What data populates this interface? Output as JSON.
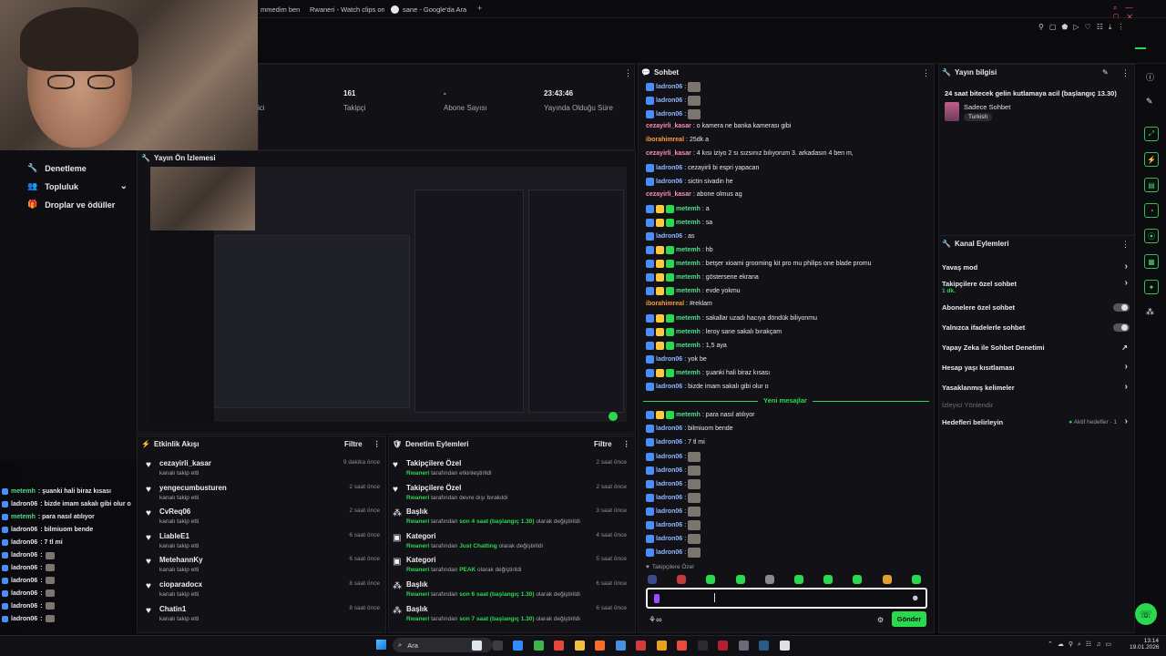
{
  "browser_tabs": [
    {
      "label": "mmedim ben"
    },
    {
      "label": "Rwaneri - Watch clips on"
    },
    {
      "label": "sane - Google'da Ara"
    }
  ],
  "left_nav": {
    "items": [
      {
        "label": "Denetleme",
        "icon": "wrench-icon"
      },
      {
        "label": "Topluluk",
        "icon": "people-icon"
      },
      {
        "label": "Droplar ve ödüller",
        "icon": "gift-icon"
      }
    ]
  },
  "stats": [
    {
      "value": "",
      "label": "ici"
    },
    {
      "value": "161",
      "label": "Takipçi"
    },
    {
      "value": "-",
      "label": "Abone Sayısı"
    },
    {
      "value": "23:43:46",
      "label": "Yayında Olduğu Süre"
    }
  ],
  "preview": {
    "title": "Yayın Ön İzlemesi"
  },
  "activity": {
    "title": "Etkinlik Akışı",
    "filter": "Filtre",
    "rows": [
      {
        "name": "cezayirli_kasar",
        "sub": "kanalı takip etti",
        "time": "9 dakika önce"
      },
      {
        "name": "yengecumbusturen",
        "sub": "kanalı takip etti",
        "time": "2 saat önce"
      },
      {
        "name": "CvReq06",
        "sub": "kanalı takip etti",
        "time": "2 saat önce"
      },
      {
        "name": "LiableE1",
        "sub": "kanalı takip etti",
        "time": "6 saat önce"
      },
      {
        "name": "MetehannKy",
        "sub": "kanalı takip etti",
        "time": "6 saat önce"
      },
      {
        "name": "cioparadocx",
        "sub": "kanalı takip etti",
        "time": "8 saat önce"
      },
      {
        "name": "Chatin1",
        "sub": "kanalı takip etti",
        "time": "8 saat önce"
      }
    ]
  },
  "mod_actions": {
    "title": "Denetim Eylemleri",
    "filter": "Filtre",
    "rows": [
      {
        "name": "Takipçilere Özel",
        "who": "Rwaneri",
        "rest": " tarafından etkinleştirildi",
        "hl": "",
        "tail": "",
        "time": "2 saat önce",
        "icon": "heart-icon"
      },
      {
        "name": "Takipçilere Özel",
        "who": "Rwaneri",
        "rest": " tarafından devre dışı bırakıldı",
        "hl": "",
        "tail": "",
        "time": "2 saat önce",
        "icon": "heart-icon"
      },
      {
        "name": "Başlık",
        "who": "Rwaneri",
        "rest": " tarafından ",
        "hl": "son 4 saat (başlangıç 1.30)",
        "tail": " olarak değiştirildi",
        "time": "3 saat önce",
        "icon": "title-icon"
      },
      {
        "name": "Kategori",
        "who": "Rwaneri",
        "rest": " tarafından ",
        "hl": "Just Chatting",
        "tail": " olarak değiştirildi",
        "time": "4 saat önce",
        "icon": "category-icon"
      },
      {
        "name": "Kategori",
        "who": "Rwaneri",
        "rest": " tarafından ",
        "hl": "PEAK",
        "tail": " olarak değiştirildi",
        "time": "5 saat önce",
        "icon": "category-icon"
      },
      {
        "name": "Başlık",
        "who": "Rwaneri",
        "rest": " tarafından ",
        "hl": "son 6 saat (başlangıç 1.30)",
        "tail": " olarak değiştirildi",
        "time": "6 saat önce",
        "icon": "title-icon"
      },
      {
        "name": "Başlık",
        "who": "Rwaneri",
        "rest": " tarafından ",
        "hl": "son 7 saat (başlangıç 1.30)",
        "tail": " olarak değiştirildi",
        "time": "6 saat önce",
        "icon": "title-icon"
      }
    ]
  },
  "chat": {
    "title": "Sohbet",
    "new_messages": "Yeni mesajlar",
    "followers_only": "Takipçilere Özel",
    "send": "Gönder",
    "messages": [
      {
        "user": "ladron06",
        "color": "blue",
        "badges": 1,
        "text": "",
        "emote": true
      },
      {
        "user": "ladron06",
        "color": "blue",
        "badges": 1,
        "text": "",
        "emote": true
      },
      {
        "user": "ladron06",
        "color": "blue",
        "badges": 1,
        "text": "",
        "emote": true
      },
      {
        "user": "cezayirli_kasar",
        "color": "pink",
        "badges": 0,
        "text": "o kamera ne banka kamerası gibi",
        "emote": false
      },
      {
        "user": "iborahimreal",
        "color": "orange",
        "badges": 0,
        "text": "25dk a",
        "emote": false
      },
      {
        "user": "cezayirli_kasar",
        "color": "pink",
        "badges": 0,
        "text": "4 kısı iziyo 2 sı sızsınız bılıyorum 3. arkadasın 4 ben m,",
        "emote": false
      },
      {
        "user": "ladron06",
        "color": "blue",
        "badges": 1,
        "text": "cezayirli bi espri yapacan",
        "emote": false
      },
      {
        "user": "ladron06",
        "color": "blue",
        "badges": 1,
        "text": "sictin sivadin he",
        "emote": false
      },
      {
        "user": "cezayirli_kasar",
        "color": "pink",
        "badges": 0,
        "text": "abone olmus ag",
        "emote": false
      },
      {
        "user": "metemh",
        "color": "green",
        "badges": 3,
        "text": "a",
        "emote": false
      },
      {
        "user": "metemh",
        "color": "green",
        "badges": 3,
        "text": "sa",
        "emote": false
      },
      {
        "user": "ladron06",
        "color": "blue",
        "badges": 1,
        "text": "as",
        "emote": false
      },
      {
        "user": "metemh",
        "color": "green",
        "badges": 3,
        "text": "hb",
        "emote": false
      },
      {
        "user": "metemh",
        "color": "green",
        "badges": 3,
        "text": "betşer xioami grooming kit pro mu philips one blade promu",
        "emote": false
      },
      {
        "user": "metemh",
        "color": "green",
        "badges": 3,
        "text": "göstersene ekrana",
        "emote": false
      },
      {
        "user": "metemh",
        "color": "green",
        "badges": 3,
        "text": "evde yokmu",
        "emote": false
      },
      {
        "user": "iborahimreal",
        "color": "orange",
        "badges": 0,
        "text": "#reklam",
        "emote": false
      },
      {
        "user": "metemh",
        "color": "green",
        "badges": 3,
        "text": "sakallar uzadı hacıya döndük biliyonmu",
        "emote": false
      },
      {
        "user": "metemh",
        "color": "green",
        "badges": 3,
        "text": "leroy sane sakalı bırakçam",
        "emote": false
      },
      {
        "user": "metemh",
        "color": "green",
        "badges": 3,
        "text": "1,5 aya",
        "emote": false
      },
      {
        "user": "ladron06",
        "color": "blue",
        "badges": 1,
        "text": "yok be",
        "emote": false
      },
      {
        "user": "metemh",
        "color": "green",
        "badges": 3,
        "text": "şuanki hali biraz kısası",
        "emote": false
      },
      {
        "user": "ladron06",
        "color": "blue",
        "badges": 1,
        "text": "bizde imam sakalı gibi olur o",
        "emote": false
      }
    ],
    "after_messages": [
      {
        "user": "metemh",
        "color": "green",
        "badges": 3,
        "text": "para nasıl atılıyor",
        "emote": false
      },
      {
        "user": "ladron06",
        "color": "blue",
        "badges": 1,
        "text": "bilmiuom bende",
        "emote": false
      },
      {
        "user": "ladron06",
        "color": "blue",
        "badges": 1,
        "text": "7 tl mi",
        "emote": false
      },
      {
        "user": "ladron06",
        "color": "blue",
        "badges": 1,
        "text": "",
        "emote": true
      },
      {
        "user": "ladron06",
        "color": "blue",
        "badges": 1,
        "text": "",
        "emote": true
      },
      {
        "user": "ladron06",
        "color": "blue",
        "badges": 1,
        "text": "",
        "emote": true
      },
      {
        "user": "ladron06",
        "color": "blue",
        "badges": 1,
        "text": "",
        "emote": true
      },
      {
        "user": "ladron06",
        "color": "blue",
        "badges": 1,
        "text": "",
        "emote": true
      },
      {
        "user": "ladron06",
        "color": "blue",
        "badges": 1,
        "text": "",
        "emote": true
      },
      {
        "user": "ladron06",
        "color": "blue",
        "badges": 1,
        "text": "",
        "emote": true
      },
      {
        "user": "ladron06",
        "color": "blue",
        "badges": 1,
        "text": "",
        "emote": true
      }
    ]
  },
  "stream_info": {
    "title": "Yayın bilgisi",
    "stream_title": "24 saat bitecek gelin kutlamaya acil (başlangıç 13.30)",
    "category": "Sadece Sohbet",
    "tag": "Turkish"
  },
  "channel_actions": {
    "title": "Kanal Eylemleri",
    "items": [
      {
        "label": "Yavaş mod",
        "sub": "",
        "control": "chevron"
      },
      {
        "label": "Takipçilere özel sohbet",
        "sub": "1 dk.",
        "control": "chevron"
      },
      {
        "label": "Abonelere özel sohbet",
        "sub": "",
        "control": "toggle"
      },
      {
        "label": "Yalnızca ifadelerle sohbet",
        "sub": "",
        "control": "toggle"
      },
      {
        "label": "Yapay Zeka ile Sohbet Denetimi",
        "sub": "",
        "control": "external"
      },
      {
        "label": "Hesap yaşı kısıtlaması",
        "sub": "",
        "control": "chevron"
      },
      {
        "label": "Yasaklanmış kelimeler",
        "sub": "",
        "control": "chevron"
      },
      {
        "label": "İzleyici Yönlendir",
        "sub": "",
        "control": "none"
      },
      {
        "label": "Hedefleri belirleyin",
        "sub": "",
        "control": "chevron"
      }
    ],
    "goal_status": "Aktif hedefler · 1"
  },
  "overlay_chat": [
    {
      "user": "metemh",
      "color": "green",
      "text": ": şuanki hali biraz kısası"
    },
    {
      "user": "ladron06",
      "color": "white",
      "text": ": bizde imam sakalı gibi olur o"
    },
    {
      "user": "metemh",
      "color": "green",
      "text": ": para nasıl atılıyor"
    },
    {
      "user": "ladron06",
      "color": "white",
      "text": ": bilmiuom bende"
    },
    {
      "user": "ladron06",
      "color": "white",
      "text": ": 7 tl mi"
    },
    {
      "user": "ladron06",
      "color": "white",
      "text": ":"
    },
    {
      "user": "ladron06",
      "color": "white",
      "text": ":"
    },
    {
      "user": "ladron06",
      "color": "white",
      "text": ":"
    },
    {
      "user": "ladron06",
      "color": "white",
      "text": ":"
    },
    {
      "user": "ladron06",
      "color": "white",
      "text": ":"
    },
    {
      "user": "ladron06",
      "color": "white",
      "text": ":"
    }
  ],
  "taskbar": {
    "search": "Ara",
    "time": "13:14",
    "date": "19.01.2026"
  },
  "colors": {
    "accent_green": "#2bd94f",
    "user_blue": "#8fb7ff",
    "user_green": "#4fe08a",
    "user_pink": "#ff8fb5",
    "user_orange": "#ff9c3a"
  }
}
